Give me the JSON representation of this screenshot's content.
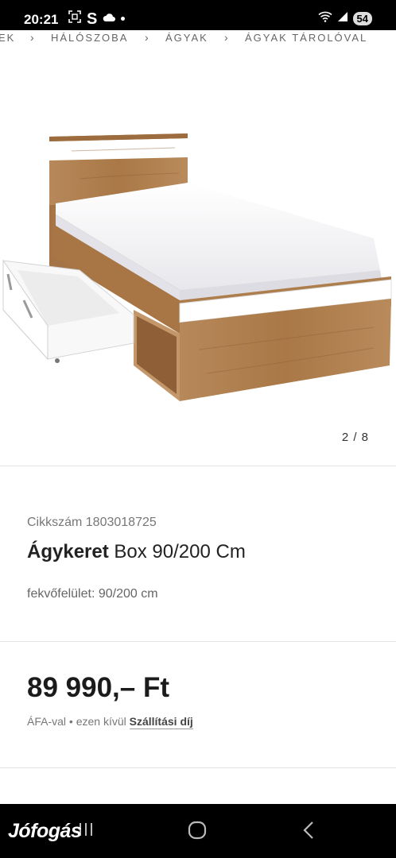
{
  "status_bar": {
    "time": "20:21",
    "s_label": "S",
    "battery": "54"
  },
  "breadcrumb": [
    "EK",
    "HÁLÓSZOBA",
    "ÁGYAK",
    "ÁGYAK TÁROLÓVAL"
  ],
  "gallery": {
    "counter": "2 / 8"
  },
  "product": {
    "sku_label": "Cikkszám 1803018725",
    "title_brand": "Ágykeret",
    "title_rest": " Box 90/200 Cm",
    "feature": "fekvőfelület: 90/200 cm",
    "price": "89 990,– Ft",
    "vat_prefix": "ÁFA-val",
    "vat_sep": " • ",
    "vat_middle": "ezen kívül ",
    "shipping_link": "Szállítási díj"
  },
  "watermark": "Jófogás",
  "icons": [
    "screenshot-icon",
    "cloud-icon",
    "wifi-icon",
    "signal-icon",
    "chevron-right-icon",
    "recent-apps-icon",
    "home-icon",
    "back-icon"
  ],
  "colors": {
    "oak": "#b07d4e",
    "oak_dark": "#8f6038",
    "mattress": "#f4f4f6",
    "white_panel": "#ffffff"
  }
}
